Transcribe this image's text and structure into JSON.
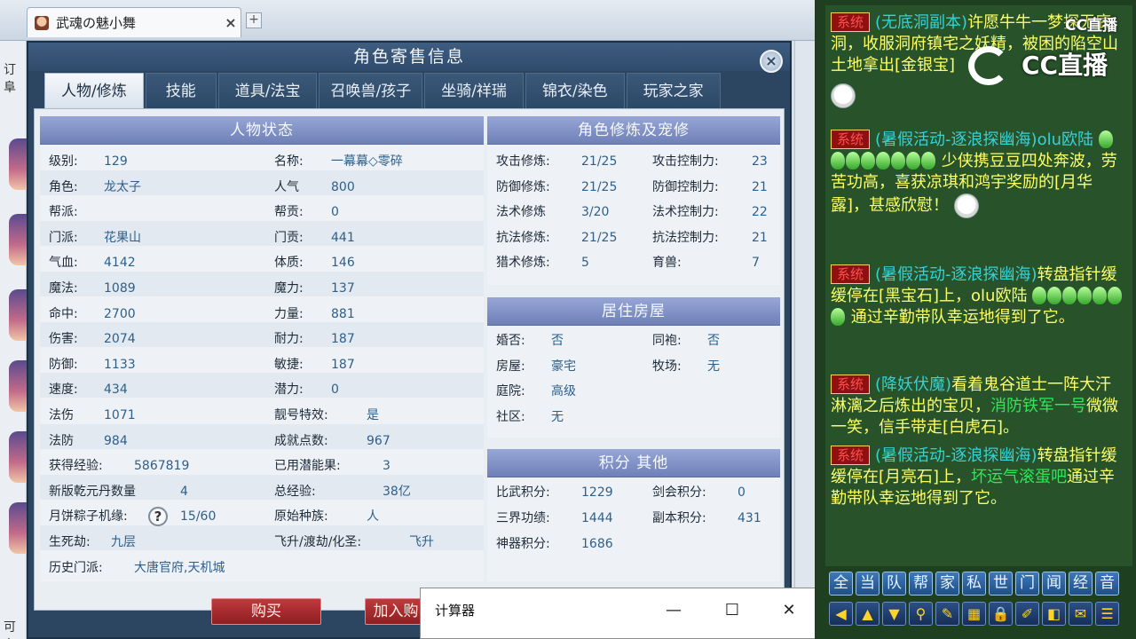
{
  "browser": {
    "tab_title": "武魂の魅小舞",
    "tab_close": "×",
    "tab_add": "+",
    "left_fragments": [
      "订阜",
      "可台"
    ]
  },
  "dialog": {
    "title": "角色寄售信息",
    "close": "×",
    "tabs": [
      "人物/修炼",
      "技能",
      "道具/法宝",
      "召唤兽/孩子",
      "坐骑/祥瑞",
      "锦衣/染色",
      "玩家之家"
    ],
    "active_tab": 0,
    "status": {
      "header": "人物状态",
      "left": [
        {
          "label": "级别:",
          "value": "129"
        },
        {
          "label": "角色:",
          "value": "龙太子"
        },
        {
          "label": "帮派:",
          "value": ""
        },
        {
          "label": "门派:",
          "value": "花果山"
        },
        {
          "label": "气血:",
          "value": "4142"
        },
        {
          "label": "魔法:",
          "value": "1089"
        },
        {
          "label": "命中:",
          "value": "2700"
        },
        {
          "label": "伤害:",
          "value": "2074"
        },
        {
          "label": "防御:",
          "value": "1133"
        },
        {
          "label": "速度:",
          "value": "434"
        },
        {
          "label": "法伤",
          "value": "1071"
        },
        {
          "label": "法防",
          "value": "984"
        },
        {
          "label": "获得经验:",
          "value": "5867819"
        },
        {
          "label": "新版乾元丹数量",
          "value": "4"
        },
        {
          "label": "月饼粽子机缘:",
          "value": "15/60"
        },
        {
          "label": "生死劫:",
          "value": "九层"
        },
        {
          "label": "历史门派:",
          "value": "大唐官府,天机城"
        }
      ],
      "right": [
        {
          "label": "名称:",
          "value": "一幕幕◇零碎"
        },
        {
          "label": "人气",
          "value": "800"
        },
        {
          "label": "帮贡:",
          "value": "0"
        },
        {
          "label": "门贡:",
          "value": "441"
        },
        {
          "label": "体质:",
          "value": "146"
        },
        {
          "label": "魔力:",
          "value": "137"
        },
        {
          "label": "力量:",
          "value": "881"
        },
        {
          "label": "耐力:",
          "value": "187"
        },
        {
          "label": "敏捷:",
          "value": "187"
        },
        {
          "label": "潜力:",
          "value": "0"
        },
        {
          "label": "靓号特效:",
          "value": "是"
        },
        {
          "label": "成就点数:",
          "value": "967"
        },
        {
          "label": "已用潜能果:",
          "value": "3"
        },
        {
          "label": "总经验:",
          "value": "38亿"
        },
        {
          "label": "原始种族:",
          "value": "人"
        },
        {
          "label": "飞升/渡劫/化圣:",
          "value": "飞升"
        }
      ],
      "help_icon": "?"
    },
    "cultivation": {
      "header": "角色修炼及宠修",
      "left": [
        {
          "label": "攻击修炼:",
          "value": "21/25"
        },
        {
          "label": "防御修炼:",
          "value": "21/25"
        },
        {
          "label": "法术修炼",
          "value": "3/20"
        },
        {
          "label": "抗法修炼:",
          "value": "21/25"
        },
        {
          "label": "猎术修炼:",
          "value": "5"
        }
      ],
      "right": [
        {
          "label": "攻击控制力:",
          "value": "23"
        },
        {
          "label": "防御控制力:",
          "value": "21"
        },
        {
          "label": "法术控制力:",
          "value": "22"
        },
        {
          "label": "抗法控制力:",
          "value": "21"
        },
        {
          "label": "育兽:",
          "value": "7"
        }
      ]
    },
    "housing": {
      "header": "居住房屋",
      "left": [
        {
          "label": "婚否:",
          "value": "否"
        },
        {
          "label": "房屋:",
          "value": "豪宅"
        },
        {
          "label": "庭院:",
          "value": "高级"
        },
        {
          "label": "社区:",
          "value": "无"
        }
      ],
      "right": [
        {
          "label": "同袍:",
          "value": "否"
        },
        {
          "label": "牧场:",
          "value": "无"
        }
      ]
    },
    "points": {
      "header": "积分 其他",
      "left": [
        {
          "label": "比武积分:",
          "value": "1229"
        },
        {
          "label": "三界功绩:",
          "value": "1444"
        },
        {
          "label": "神器积分:",
          "value": "1686"
        }
      ],
      "right": [
        {
          "label": "剑会积分:",
          "value": "0"
        },
        {
          "label": "副本积分:",
          "value": "431"
        }
      ]
    },
    "buttons": {
      "buy": "购买",
      "add": "加入购"
    }
  },
  "calculator": {
    "title": "计算器",
    "minimize": "—",
    "maximize": "☐",
    "close": "✕"
  },
  "chat": {
    "watermark": "CC直播",
    "watermark_small": "CC直播",
    "system_tag": "系统",
    "messages": [
      {
        "tag": "(无底洞副本)",
        "text": "许愿牛牛一梦探无底洞，收服洞府镇宅之妖精，被困的陷空山土地拿出[金银宝]"
      },
      {
        "tag": "(暑假活动-逐浪探幽海)",
        "player": "olu欧陆",
        "text": "少侠携豆豆四处奔波，劳苦功高，喜获凉琪和鸿宇奖励的[月华露]，甚感欣慰！"
      },
      {
        "tag": "(暑假活动-逐浪探幽海)",
        "text1": "转盘指针缓缓停在[黑宝石]上，olu欧陆",
        "text2": "通过辛勤带队幸运地得到了它。"
      },
      {
        "tag": "(降妖伏魔)",
        "text1": "看着鬼谷道士一阵大汗淋漓之后炼出的宝贝，",
        "green": "消防铁军一号",
        "text2": "微微一笑，信手带走[白虎石]。"
      },
      {
        "tag": "(暑假活动-逐浪探幽海)",
        "text1": "转盘指针缓缓停在[月亮石]上，",
        "green": "坏运气滚蛋吧",
        "text2": "通过辛勤带队幸运地得到了它。"
      }
    ],
    "channels": [
      "全",
      "当",
      "队",
      "帮",
      "家",
      "私",
      "世",
      "门",
      "闻",
      "经",
      "音"
    ],
    "tools": [
      "◀",
      "▲",
      "▼",
      "⚲",
      "✎",
      "▦",
      "🔒",
      "✐",
      "◧",
      "✉",
      "☰"
    ]
  }
}
